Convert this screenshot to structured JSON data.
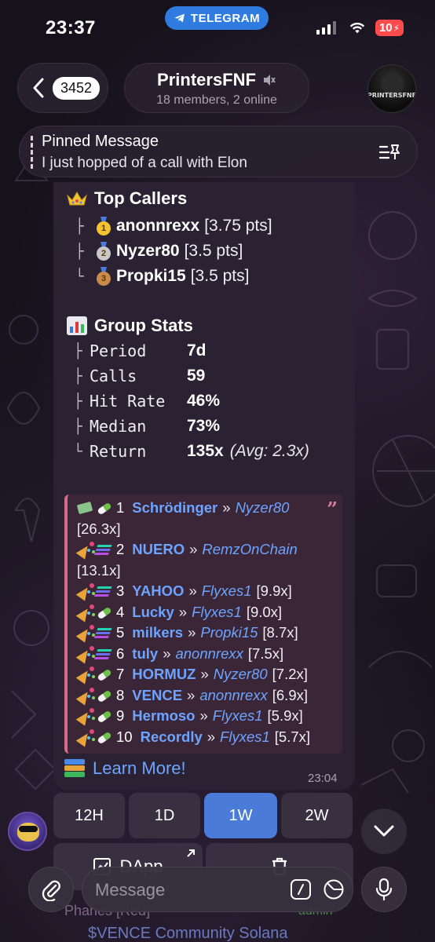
{
  "status_bar": {
    "time": "23:37",
    "app_pill": "TELEGRAM",
    "battery": "10"
  },
  "header": {
    "back_count": "3452",
    "title": "PrintersFNF",
    "subtitle": "18 members, 2 online",
    "avatar_label": "PRINTERSFNF"
  },
  "pinned": {
    "title": "Pinned Message",
    "text": "I just hopped of a call with Elon"
  },
  "message": {
    "top_callers_title": "Top Callers",
    "top_callers": [
      {
        "rank": "1",
        "name": "anonnrexx",
        "pts": "[3.75 pts]",
        "medal_color": "#f2c230"
      },
      {
        "rank": "2",
        "name": "Nyzer80",
        "pts": "[3.5 pts]",
        "medal_color": "#c8c8c8"
      },
      {
        "rank": "3",
        "name": "Propki15",
        "pts": "[3.5 pts]",
        "medal_color": "#c98a4a"
      }
    ],
    "group_stats_title": "Group Stats",
    "stats": [
      {
        "label": "Period",
        "value": "7d",
        "extra": ""
      },
      {
        "label": "Calls",
        "value": "59",
        "extra": ""
      },
      {
        "label": "Hit Rate",
        "value": "46%",
        "extra": ""
      },
      {
        "label": "Median",
        "value": "73%",
        "extra": ""
      },
      {
        "label": "Return",
        "value": "135x",
        "extra": "(Avg: 2.3x)"
      }
    ],
    "calls": [
      {
        "num": "1",
        "token": "Schrödinger",
        "caller": "Nyzer80",
        "mult": "[26.3x]"
      },
      {
        "num": "2",
        "token": "NUERO",
        "caller": "RemzOnChain",
        "mult": "[13.1x]"
      },
      {
        "num": "3",
        "token": "YAHOO",
        "caller": "Flyxes1",
        "mult": "[9.9x]"
      },
      {
        "num": "4",
        "token": "Lucky",
        "caller": "Flyxes1",
        "mult": "[9.0x]"
      },
      {
        "num": "5",
        "token": "milkers",
        "caller": "Propki15",
        "mult": "[8.7x]"
      },
      {
        "num": "6",
        "token": "tuly",
        "caller": "anonnrexx",
        "mult": "[7.5x]"
      },
      {
        "num": "7",
        "token": "HORMUZ",
        "caller": "Nyzer80",
        "mult": "[7.2x]"
      },
      {
        "num": "8",
        "token": "VENCE",
        "caller": "anonnrexx",
        "mult": "[6.9x]"
      },
      {
        "num": "9",
        "token": "Hermoso",
        "caller": "Flyxes1",
        "mult": "[5.9x]"
      },
      {
        "num": "10",
        "token": "Recordly",
        "caller": "Flyxes1",
        "mult": "[5.7x]"
      }
    ],
    "separator": "»",
    "learn_more": "Learn More!",
    "time": "23:04"
  },
  "inline_buttons": {
    "periods": [
      "12H",
      "1D",
      "1W",
      "2W"
    ],
    "active_period": "1W",
    "dapp_label": "DApp"
  },
  "below": {
    "sender": "Phanes [Red]",
    "sender_tag": "admin",
    "preview": "$VENCE Community Solana"
  },
  "composer": {
    "placeholder": "Message"
  },
  "colors": {
    "accent": "#4a7bd8",
    "link": "#6ea4ff",
    "quote_border": "#d86a8a",
    "battery": "#ff4b4b"
  }
}
